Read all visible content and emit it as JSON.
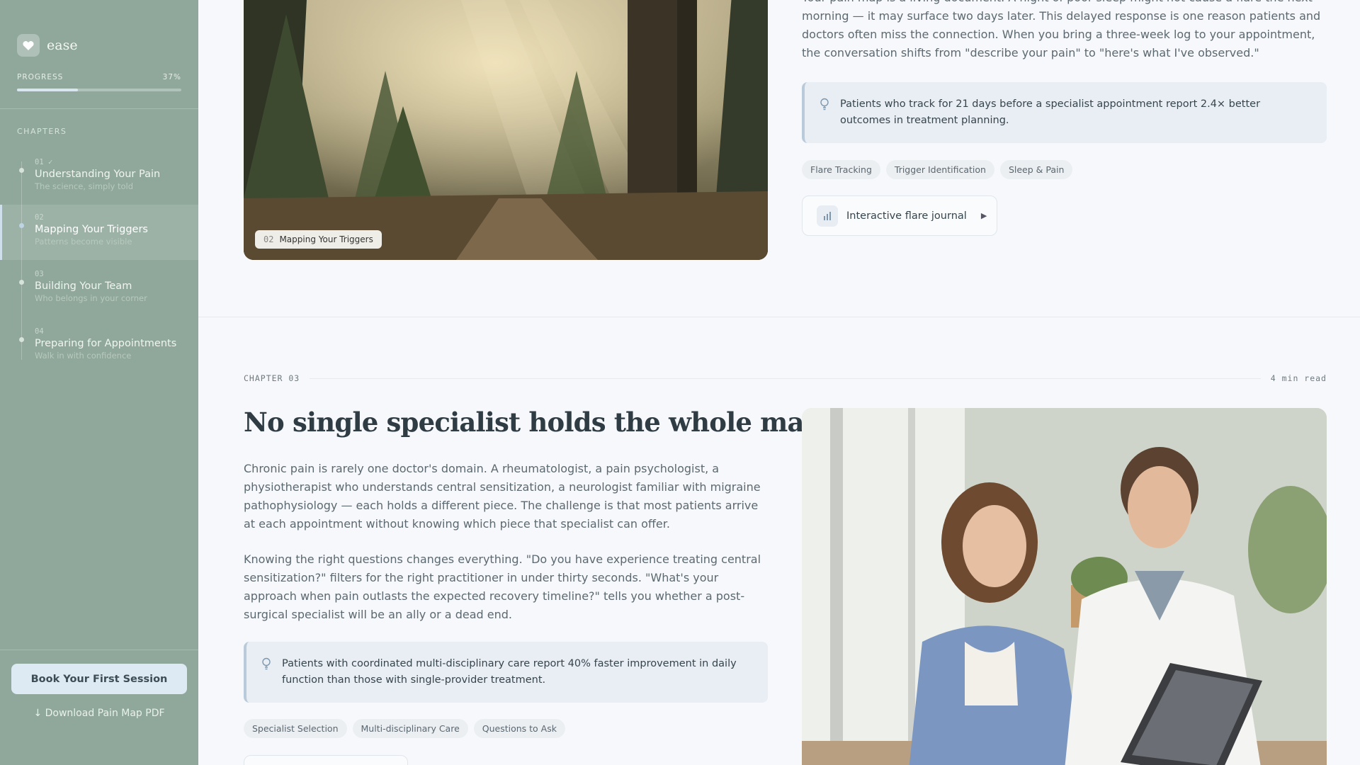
{
  "app": {
    "brand_name": "ease"
  },
  "progress": {
    "label": "PROGRESS",
    "value_text": "37%",
    "value": 0.37
  },
  "chapters_label": "CHAPTERS",
  "chapters": [
    {
      "num": "01 ✓",
      "title": "Understanding Your Pain",
      "subtitle": "The science, simply told",
      "active": false
    },
    {
      "num": "02",
      "title": "Mapping Your Triggers",
      "subtitle": "Patterns become visible",
      "active": true
    },
    {
      "num": "03",
      "title": "Building Your Team",
      "subtitle": "Who belongs in your corner",
      "active": false
    },
    {
      "num": "04",
      "title": "Preparing for Appointments",
      "subtitle": "Walk in with confidence",
      "active": false
    }
  ],
  "sidebar_actions": {
    "book_label": "Book Your First Session",
    "download_label": "↓ Download Pain Map PDF"
  },
  "chapter02": {
    "image_caption_num": "02",
    "image_caption_title": "Mapping Your Triggers",
    "body_text": "Your pain map is a living document. A night of poor sleep might not cause a flare the next morning — it may surface two days later. This delayed response is one reason patients and doctors often miss the connection. When you bring a three-week log to your appointment, the conversation shifts from \"describe your pain\" to \"here's what I've observed.\"",
    "callout": "Patients who track for 21 days before a specialist appointment report 2.4× better outcomes in treatment planning.",
    "tags": [
      "Flare Tracking",
      "Trigger Identification",
      "Sleep & Pain"
    ],
    "journal_label": "Interactive flare journal"
  },
  "chapter03": {
    "label": "CHAPTER 03",
    "read_time": "4 min read",
    "heading": "No single specialist holds the whole map.",
    "paragraph1": "Chronic pain is rarely one doctor's domain. A rheumatologist, a pain psychologist, a physiotherapist who understands central sensitization, a neurologist familiar with migraine pathophysiology — each holds a different piece. The challenge is that most patients arrive at each appointment without knowing which piece that specialist can offer.",
    "paragraph2": "Knowing the right questions changes everything. \"Do you have experience treating central sensitization?\" filters for the right practitioner in under thirty seconds. \"What's your approach when pain outlasts the expected recovery timeline?\" tells you whether a post-surgical specialist will be an ally or a dead end.",
    "callout": "Patients with coordinated multi-disciplinary care report 40% faster improvement in daily function than those with single-provider treatment.",
    "tags": [
      "Specialist Selection",
      "Multi-disciplinary Care",
      "Questions to Ask"
    ]
  }
}
